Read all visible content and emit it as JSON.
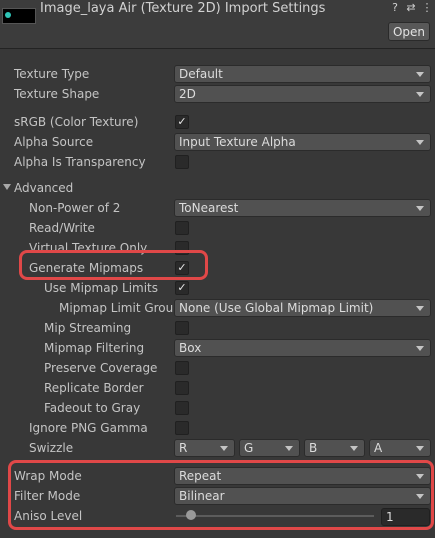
{
  "header": {
    "title": "Image_laya Air (Texture 2D) Import Settings",
    "icons": [
      "help-icon",
      "preset-sliders-icon",
      "kebab-menu-icon"
    ],
    "open_label": "Open"
  },
  "fields": {
    "texture_type": {
      "label": "Texture Type",
      "value": "Default"
    },
    "texture_shape": {
      "label": "Texture Shape",
      "value": "2D"
    },
    "srgb": {
      "label": "sRGB (Color Texture)",
      "checked": true
    },
    "alpha_source": {
      "label": "Alpha Source",
      "value": "Input Texture Alpha"
    },
    "alpha_is_transparency": {
      "label": "Alpha Is Transparency",
      "checked": false
    },
    "advanced": {
      "label": "Advanced",
      "expanded": true
    },
    "non_power_of_2": {
      "label": "Non-Power of 2",
      "value": "ToNearest"
    },
    "read_write": {
      "label": "Read/Write",
      "checked": false
    },
    "virtual_texture_only": {
      "label": "Virtual Texture Only",
      "checked": false
    },
    "generate_mipmaps": {
      "label": "Generate Mipmaps",
      "checked": true
    },
    "use_mipmap_limits": {
      "label": "Use Mipmap Limits",
      "checked": true
    },
    "mipmap_limit_group": {
      "label": "Mipmap Limit Group",
      "value": "None (Use Global Mipmap Limit)"
    },
    "mip_streaming": {
      "label": "Mip Streaming",
      "checked": false
    },
    "mipmap_filtering": {
      "label": "Mipmap Filtering",
      "value": "Box"
    },
    "preserve_coverage": {
      "label": "Preserve Coverage",
      "checked": false
    },
    "replicate_border": {
      "label": "Replicate Border",
      "checked": false
    },
    "fadeout_to_gray": {
      "label": "Fadeout to Gray",
      "checked": false
    },
    "ignore_png_gamma": {
      "label": "Ignore PNG Gamma",
      "checked": false
    },
    "swizzle": {
      "label": "Swizzle",
      "r": "R",
      "g": "G",
      "b": "B",
      "a": "A"
    },
    "wrap_mode": {
      "label": "Wrap Mode",
      "value": "Repeat"
    },
    "filter_mode": {
      "label": "Filter Mode",
      "value": "Bilinear"
    },
    "aniso_level": {
      "label": "Aniso Level",
      "value": "1",
      "slider_fraction": 0.06
    }
  },
  "colors": {
    "background": "#383838",
    "highlight": "#e04848",
    "text": "#c4c4c4"
  }
}
